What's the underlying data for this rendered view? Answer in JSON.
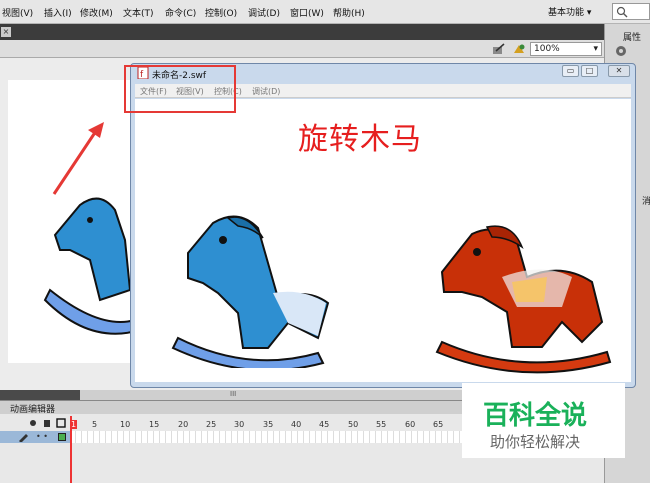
{
  "menubar": {
    "items": [
      "视图(V)",
      "插入(I)",
      "修改(M)",
      "文本(T)",
      "命令(C)",
      "控制(O)",
      "调试(D)",
      "窗口(W)",
      "帮助(H)"
    ],
    "workspace": "基本功能 ▾"
  },
  "stage_toolbar": {
    "zoom": "100%"
  },
  "right_panel": {
    "label": "属性",
    "label2": "消"
  },
  "timeline": {
    "tab": "动画编辑器",
    "ticks": [
      "5",
      "10",
      "15",
      "20",
      "25",
      "30",
      "35",
      "40",
      "45",
      "50",
      "55",
      "60",
      "65"
    ],
    "current_frame": "1"
  },
  "swf_window": {
    "title": "未命名-2.swf",
    "menu": [
      "文件(F)",
      "视图(V)",
      "控制(C)",
      "调试(D)"
    ],
    "heading": "旋转木马",
    "buttons": {
      "minimize": "▭",
      "maximize": "□",
      "close": "✕"
    }
  },
  "scrollbar": {
    "grip": "III"
  },
  "watermark": {
    "title": "百科全说",
    "subtitle": "助你轻松解决"
  },
  "colors": {
    "highlight": "#e53935",
    "heading": "#e61e1e",
    "brand": "#1ab15a"
  }
}
